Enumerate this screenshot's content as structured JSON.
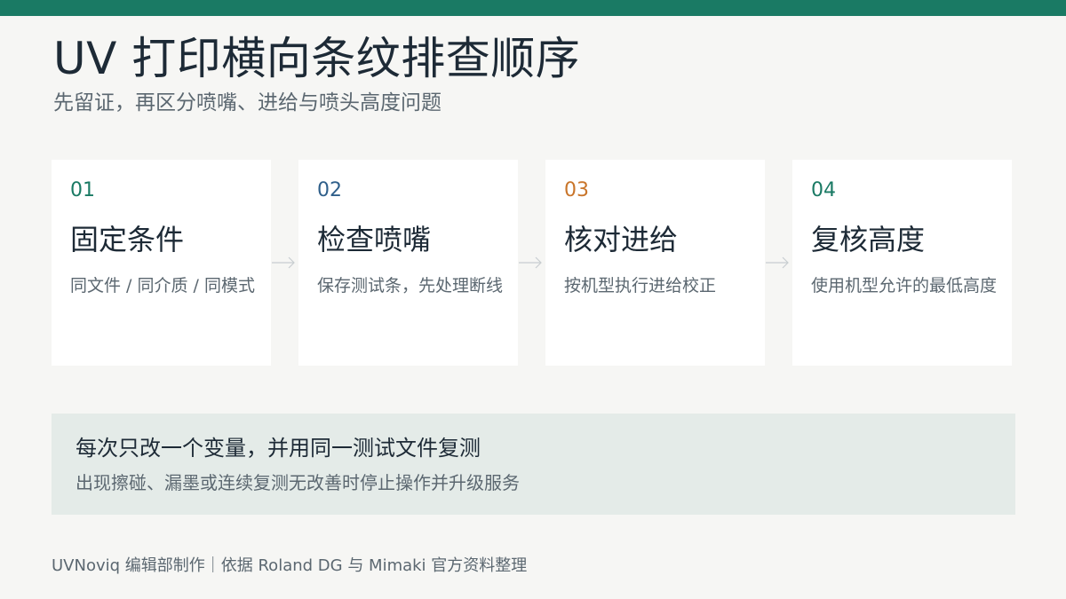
{
  "colors": {
    "accent_bar": "#1a7a64",
    "step_1": "#1a7a64",
    "step_2": "#2f5f8a",
    "step_3": "#c9752a",
    "step_4": "#1a7a64"
  },
  "header": {
    "title": "UV 打印横向条纹排查顺序",
    "subtitle": "先留证，再区分喷嘴、进给与喷头高度问题"
  },
  "steps": [
    {
      "num": "01",
      "name": "固定条件",
      "desc": "同文件 / 同介质 / 同模式"
    },
    {
      "num": "02",
      "name": "检查喷嘴",
      "desc": "保存测试条，先处理断线"
    },
    {
      "num": "03",
      "name": "核对进给",
      "desc": "按机型执行进给校正"
    },
    {
      "num": "04",
      "name": "复核高度",
      "desc": "使用机型允许的最低高度"
    }
  ],
  "arrows": {
    "icon": "arrow-right-icon"
  },
  "note": {
    "main": "每次只改一个变量，并用同一测试文件复测",
    "sub": "出现擦碰、漏墨或连续复测无改善时停止操作并升级服务"
  },
  "footer": {
    "text": "UVNoviq 编辑部制作｜依据 Roland DG 与 Mimaki 官方资料整理"
  }
}
